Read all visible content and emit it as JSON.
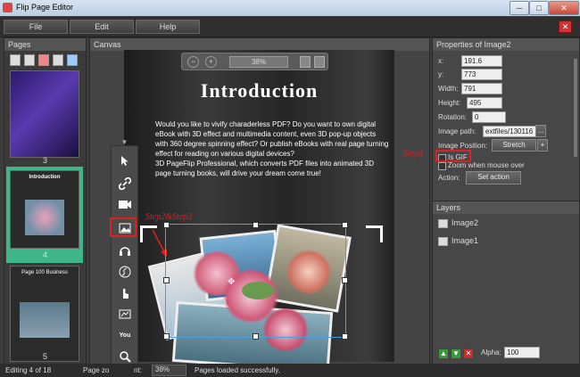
{
  "window": {
    "title": "Flip Page Editor",
    "buttons": [
      "─",
      "□",
      "✕"
    ]
  },
  "menu": {
    "file": "File",
    "edit": "Edit",
    "help": "Help",
    "close": "✕"
  },
  "pages_panel": {
    "title": "Pages",
    "page_numbers": [
      "3",
      "4",
      "5"
    ],
    "thumb_texts": {
      "page4": "Introduction",
      "page5": "Page 100 Business"
    }
  },
  "canvas_panel": {
    "title": "Canvas",
    "zoom": "38%",
    "zoom_minus": "−",
    "zoom_plus": "+"
  },
  "page": {
    "title": "Introduction",
    "body": "Would you like to vivify charaderless PDF? Do you want to own digital eBook with 3D effect and multimedia content, even 3D pop-up objects with 360 degree spinning effect? Or publish eBooks with real page turning effect for reading on various digital devices?\n3D PageFlip Professional, which converts PDF files into animated 3D page turning books, will drive your dream come true!"
  },
  "annotations": {
    "step23": "Step2&Step3",
    "step4": "Step4"
  },
  "properties": {
    "title": "Properties of Image2",
    "x_label": "x:",
    "x": "191.6",
    "y_label": "y:",
    "y": "773",
    "width_label": "Width:",
    "width": "791",
    "height_label": "Height:",
    "height": "495",
    "rotation_label": "Rotation:",
    "rotation": "0",
    "image_path_label": "Image path:",
    "image_path": "extfiles/130116",
    "image_path_btn": "...",
    "image_position_label": "Image Position:",
    "image_position": "Stretch",
    "image_position_btn": "+",
    "is_gif_label": "Is GIF",
    "zoom_label": "Zoom when mouse over",
    "action_label": "Action:",
    "action_btn": "Set action"
  },
  "layers": {
    "title": "Layers",
    "items": [
      "Image2",
      "Image1"
    ],
    "alpha_label": "Alpha:",
    "alpha": "100"
  },
  "status": {
    "editing": "Editing 4 of 18",
    "page_zoom_label": "Page zo",
    "page_zoom_label2": "nt:",
    "page_zoom": "38%",
    "message": "Pages loaded successfully."
  },
  "colors": {
    "accent_selected": "#3fb58a",
    "highlight": "#e02020",
    "selection": "#4aa0e0"
  }
}
